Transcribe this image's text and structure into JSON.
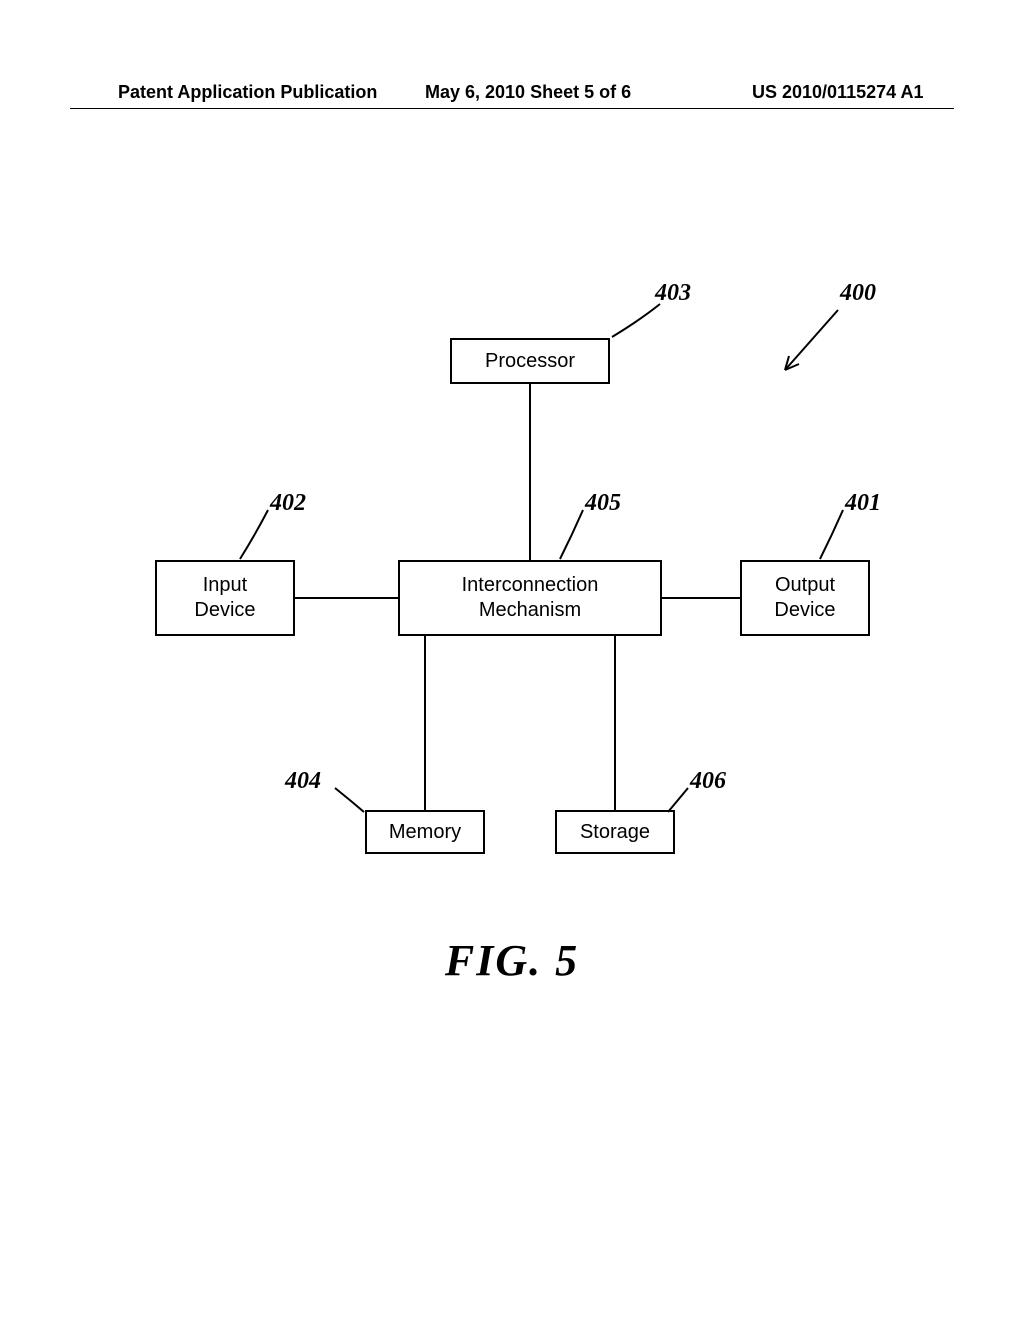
{
  "header": {
    "left": "Patent Application Publication",
    "center": "May 6, 2010  Sheet 5 of 6",
    "right": "US 2010/0115274 A1"
  },
  "boxes": {
    "processor": "Processor",
    "input": "Input\nDevice",
    "inter": "Interconnection\nMechanism",
    "output": "Output\nDevice",
    "memory": "Memory",
    "storage": "Storage"
  },
  "refs": {
    "r400": "400",
    "r401": "401",
    "r402": "402",
    "r403": "403",
    "r404": "404",
    "r405": "405",
    "r406": "406"
  },
  "caption": "FIG.  5"
}
